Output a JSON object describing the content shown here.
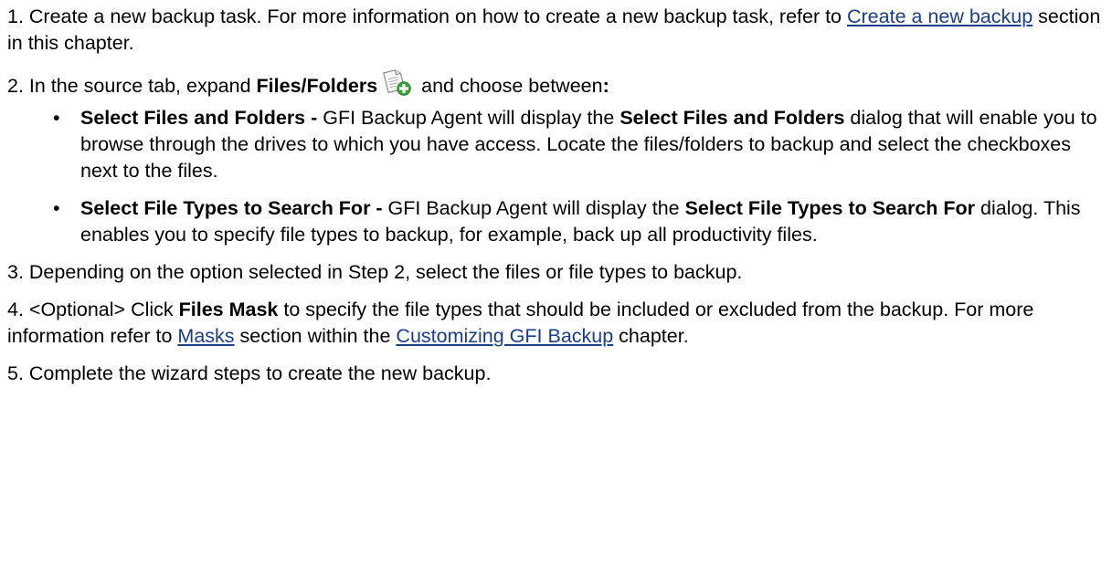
{
  "steps": {
    "s1": {
      "prefix": "1. Create a new backup task. For more information on how to create a new backup task, refer to ",
      "link": "Create a new backup",
      "suffix": " section in this chapter."
    },
    "s2": {
      "prefix": "2. In the source tab, expand ",
      "bold": "Files/Folders",
      "icon": "add-file-icon",
      "suffix": " and choose between",
      "colon": ":"
    },
    "bullets": [
      {
        "title": "Select Files and Folders -",
        "text1": " GFI Backup Agent will display the ",
        "bold2": "Select Files and Folders",
        "text2": " dialog that will enable you to browse through the drives to which you have access. Locate the files/folders to backup and select the checkboxes next to the files."
      },
      {
        "title": "Select File Types to Search For -",
        "text1": " GFI Backup Agent will display the ",
        "bold2": "Select File Types to Search For",
        "text2": " dialog. This enables you to specify file types to backup, for example, back up all productivity files."
      }
    ],
    "s3": {
      "text": "3. Depending on the option selected in Step 2, select the files or file types to backup."
    },
    "s4": {
      "prefix": "4. <Optional> Click ",
      "bold": "Files Mask",
      "mid1": " to specify the file types that should be included or excluded from the backup. For more information refer to ",
      "link1": "Masks",
      "mid2": " section within the ",
      "link2": "Customizing GFI Backup",
      "suffix": " chapter."
    },
    "s5": {
      "text": "5. Complete the wizard steps to create the new backup."
    }
  },
  "bullet_glyph": "•",
  "colors": {
    "link": "#1a3e8c",
    "text": "#000000"
  }
}
